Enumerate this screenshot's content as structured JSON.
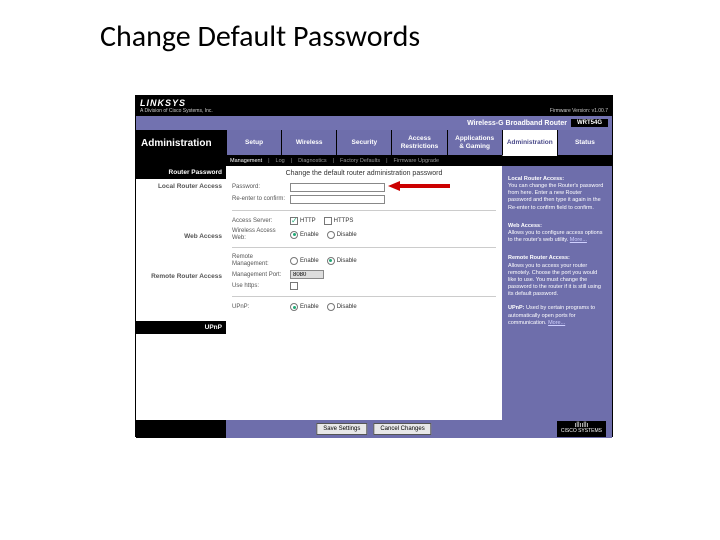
{
  "slide": {
    "title": "Change Default Passwords"
  },
  "brand": {
    "logo": "LINKSYS",
    "sub": "A Division of Cisco Systems, Inc.",
    "firmware": "Firmware Version: v1.00.7"
  },
  "product": {
    "name": "Wireless-G Broadband Router",
    "model": "WRT54G"
  },
  "section": "Administration",
  "tabs": [
    {
      "label": "Setup"
    },
    {
      "label": "Wireless"
    },
    {
      "label": "Security"
    },
    {
      "label": "Access\nRestrictions"
    },
    {
      "label": "Applications\n& Gaming"
    },
    {
      "label": "Administration"
    },
    {
      "label": "Status"
    }
  ],
  "subtabs": {
    "items": [
      "Management",
      "Log",
      "Diagnostics",
      "Factory Defaults",
      "Firmware Upgrade"
    ]
  },
  "left": {
    "l1": "Router Password",
    "l2": "Local Router Access",
    "l3": "Web Access",
    "l4": "Remote Router Access",
    "l5": "UPnP"
  },
  "center": {
    "instruction": "Change the default router administration password",
    "password_label": "Password:",
    "confirm_label": "Re-enter to confirm:",
    "access_server_label": "Access Server:",
    "http": "HTTP",
    "https": "HTTPS",
    "wireless_web_label": "Wireless Access Web:",
    "enable": "Enable",
    "disable": "Disable",
    "remote_mgmt_label": "Remote Management:",
    "mgmt_port_label": "Management Port:",
    "mgmt_port_value": "8080",
    "use_https_label": "Use https:",
    "upnp_label": "UPnP:"
  },
  "help": {
    "t1": "Local Router Access:",
    "p1": "You can change the Router's password from here. Enter a new Router password and then type it again in the Re-enter to confirm field to confirm.",
    "t2": "Web Access:",
    "p2": "Allows you to configure access options to the router's web utility.",
    "more": "More...",
    "t3": "Remote Router Access:",
    "p3": "Allows you to access your router remotely. Choose the port you would like to use. You must change the password to the router if it is still using its default password.",
    "t4": "UPnP:",
    "p4": "Used by certain programs to automatically open ports for communication."
  },
  "footer": {
    "save": "Save Settings",
    "cancel": "Cancel Changes",
    "cisco": "CISCO SYSTEMS"
  }
}
